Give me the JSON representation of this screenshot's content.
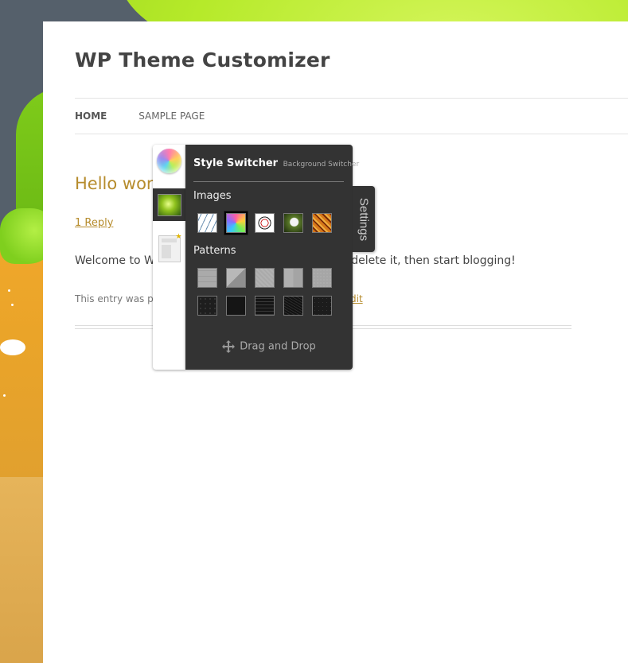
{
  "site": {
    "title": "WP Theme Customizer"
  },
  "nav": {
    "items": [
      {
        "label": "HOME",
        "current": true
      },
      {
        "label": "SAMPLE PAGE",
        "current": false
      }
    ]
  },
  "post": {
    "title_visible": "Hello wor",
    "reply_link": "1 Reply",
    "excerpt_left": "Welcome to Wo",
    "excerpt_right": "r delete it, then start blogging!",
    "meta_left": "This entry was po",
    "meta_right_link": "dit"
  },
  "switcher": {
    "title": "Style Switcher",
    "subtitle": "Background Switcher",
    "images_label": "Images",
    "patterns_label": "Patterns",
    "footer": "Drag and Drop",
    "settings_tab": "Settings",
    "tabs": [
      {
        "icon": "color-wheel-icon"
      },
      {
        "icon": "background-image-icon",
        "active": true
      },
      {
        "icon": "layout-icon"
      }
    ],
    "selected_image_index": 1
  },
  "colors": {
    "link": "#b68c2d",
    "panel": "#333333",
    "title": "#444444"
  }
}
